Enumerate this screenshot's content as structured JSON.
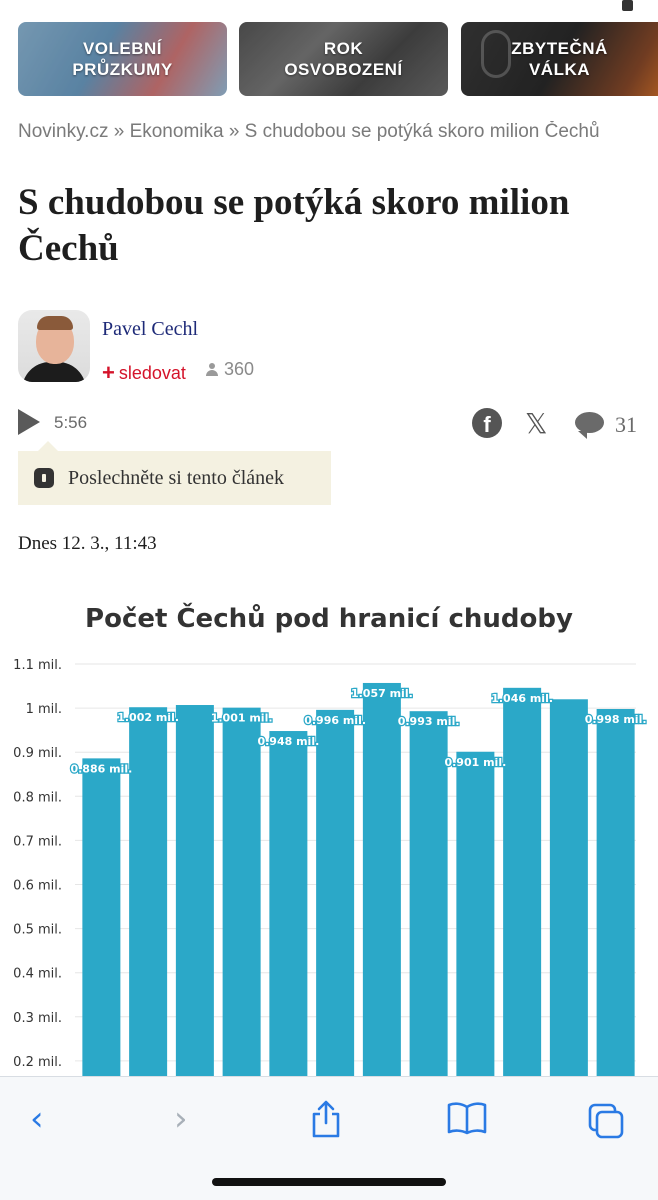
{
  "tiles": [
    {
      "label": "VOLEBNÍ\nPRŮZKUMY"
    },
    {
      "label": "ROK\nOSVOBOZENÍ"
    },
    {
      "label": "ZBYTEČNÁ\nVÁLKA"
    }
  ],
  "breadcrumb": "Novinky.cz » Ekonomika » S chudobou se potýká skoro milion Čechů",
  "article": {
    "title": "S chudobou se potýká skoro milion Čechů",
    "author": "Pavel Cechl",
    "follow_label": "sledovat",
    "follow_plus": "+",
    "followers": "360",
    "audio_duration": "5:56",
    "comment_count": "31",
    "listen_tip": "Poslechněte si tento článek",
    "date": "Dnes 12. 3., 11:43",
    "facebook_letter": "f",
    "x_letter": "𝕏"
  },
  "browser": {
    "back": "‹",
    "forward": "›"
  },
  "colors": {
    "bar": "#2ba8c8",
    "accent_red": "#d4132a",
    "author_blue": "#1e2a78",
    "safari_blue": "#2a7ae4"
  },
  "chart_data": {
    "type": "bar",
    "title": "Počet Čechů pod hranicí chudoby",
    "values": [
      0.886,
      1.002,
      1.007,
      1.001,
      0.948,
      0.996,
      1.057,
      0.993,
      0.901,
      1.046,
      1.02,
      0.998
    ],
    "data_labels": [
      "0.886 mil.",
      "1.002 mil.",
      "",
      "1.001 mil.",
      "0.948 mil.",
      "0.996 mil.",
      "1.057 mil.",
      "0.993 mil.",
      "0.901 mil.",
      "1.046 mil.",
      "",
      "0.998 mil."
    ],
    "y_ticks": [
      "1.1 mil.",
      "1 mil.",
      "0.9 mil.",
      "0.8 mil.",
      "0.7 mil.",
      "0.6 mil.",
      "0.5 mil.",
      "0.4 mil.",
      "0.3 mil.",
      "0.2 mil."
    ],
    "y_tick_values": [
      1.1,
      1.0,
      0.9,
      0.8,
      0.7,
      0.6,
      0.5,
      0.4,
      0.3,
      0.2
    ],
    "grid": true
  }
}
